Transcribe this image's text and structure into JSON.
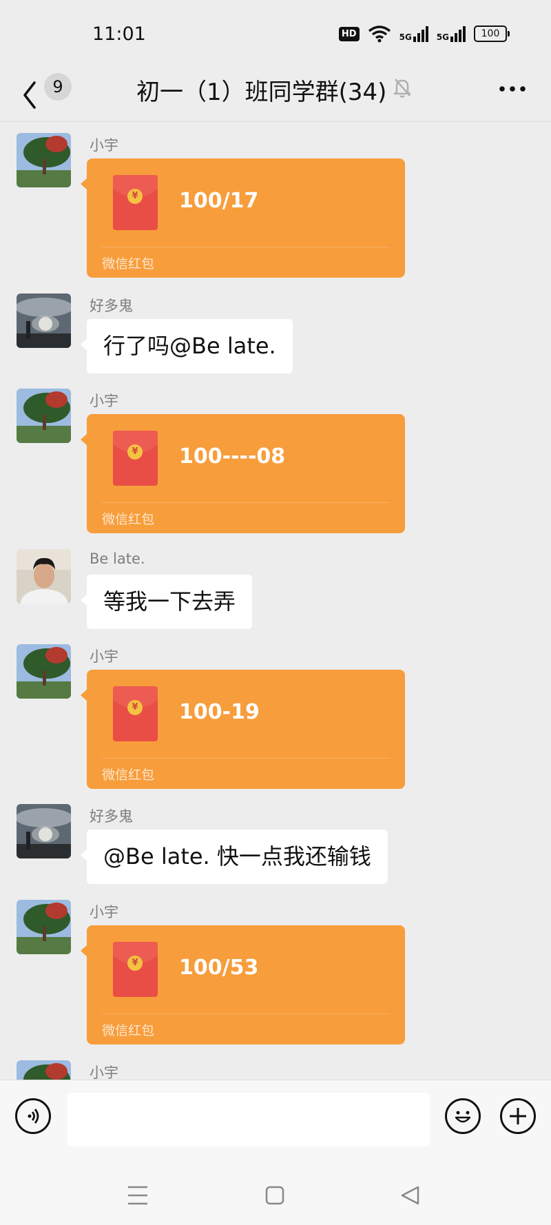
{
  "status_bar": {
    "time": "11:01",
    "hd": "HD",
    "network1": "5G",
    "network2": "5G",
    "battery": "100"
  },
  "header": {
    "unread_count": "9",
    "title": "初一（1）班同学群(34)"
  },
  "messages": [
    {
      "type": "red_packet",
      "sender": "小宇",
      "text": "100/17",
      "label": "微信红包"
    },
    {
      "type": "text",
      "sender": "好多鬼",
      "text": "行了吗@Be late."
    },
    {
      "type": "red_packet",
      "sender": "小宇",
      "text": "100----08",
      "label": "微信红包"
    },
    {
      "type": "text",
      "sender": "Be late.",
      "text": "等我一下去弄"
    },
    {
      "type": "red_packet",
      "sender": "小宇",
      "text": "100-19",
      "label": "微信红包"
    },
    {
      "type": "text",
      "sender": "好多鬼",
      "text": "@Be late.  快一点我还输钱"
    },
    {
      "type": "red_packet",
      "sender": "小宇",
      "text": "100/53",
      "label": "微信红包"
    },
    {
      "type": "partial",
      "sender": "小宇"
    }
  ],
  "input": {
    "value": ""
  },
  "colors": {
    "red_packet": "#f89d3b",
    "background": "#ededed"
  },
  "icons": [
    "back-icon",
    "mute-bell-icon",
    "more-icon",
    "voice-icon",
    "emoji-icon",
    "plus-icon",
    "menu-icon",
    "home-icon",
    "back-triangle-icon"
  ]
}
